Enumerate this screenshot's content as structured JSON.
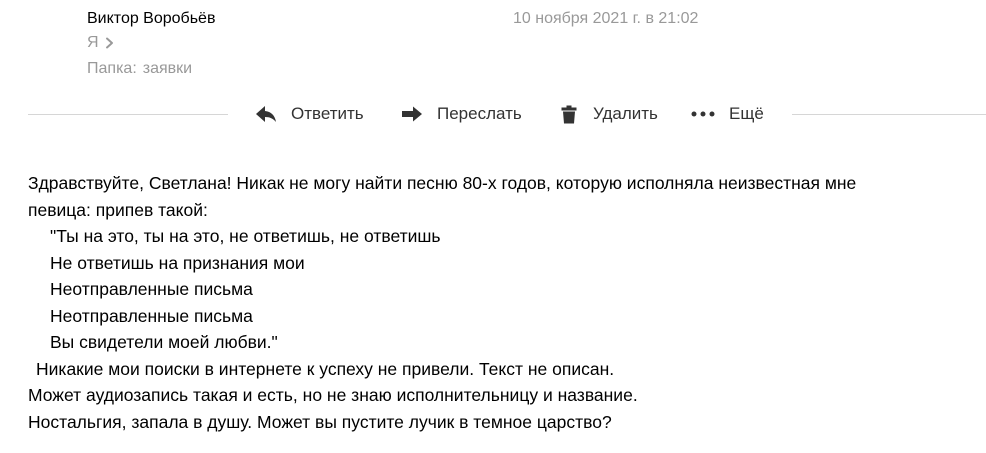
{
  "header": {
    "sender_name": "Виктор Воробьёв",
    "date": "10 ноября 2021 г. в 21:02",
    "recipient": "Я",
    "folder_label": "Папка:",
    "folder_name": "заявки"
  },
  "toolbar": {
    "reply_label": "Ответить",
    "forward_label": "Переслать",
    "delete_label": "Удалить",
    "more_label": "Ещё"
  },
  "icons": {
    "reply": "reply-arrow-icon",
    "forward": "forward-arrow-icon",
    "delete": "trash-icon",
    "more": "more-dots-icon",
    "recipient_expand": "chevron-right-icon"
  },
  "colors": {
    "muted_text": "#999999",
    "toolbar_text": "#333333",
    "icon": "#333333",
    "divider": "#d6d6d6"
  },
  "message": {
    "lines": [
      "Здравствуйте, Светлана! Никак не могу найти песню 80-х годов, которую исполняла неизвестная мне",
      "певица: припев такой:",
      "\"Ты на это, ты на это, не ответишь, не ответишь",
      "Не ответишь на признания мои",
      "Неотправленные письма",
      "Неотправленные письма",
      "Вы свидетели моей любви.\"",
      "Никакие мои поиски в интернете к успеху не привели. Текст не описан.",
      "Может аудиозапись такая и есть, но не знаю исполнительницу и название.",
      "Ностальгия, запала в душу. Может вы пустите лучик в темное царство?"
    ]
  }
}
